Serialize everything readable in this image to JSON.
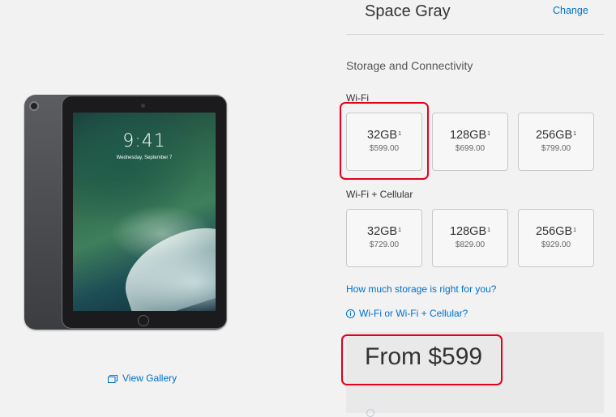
{
  "product": {
    "lockscreen_time": "9:41",
    "lockscreen_date": "Wednesday, September 7"
  },
  "gallery": {
    "label": "View Gallery",
    "icon": "gallery-icon"
  },
  "color": {
    "name": "Space Gray",
    "change_label": "Change"
  },
  "storage": {
    "section_title": "Storage and Connectivity",
    "wifi": {
      "label": "Wi-Fi",
      "options": [
        {
          "capacity": "32GB",
          "footnote": "1",
          "price": "$599.00"
        },
        {
          "capacity": "128GB",
          "footnote": "1",
          "price": "$699.00"
        },
        {
          "capacity": "256GB",
          "footnote": "1",
          "price": "$799.00"
        }
      ]
    },
    "cellular": {
      "label": "Wi-Fi + Cellular",
      "options": [
        {
          "capacity": "32GB",
          "footnote": "1",
          "price": "$729.00"
        },
        {
          "capacity": "128GB",
          "footnote": "1",
          "price": "$829.00"
        },
        {
          "capacity": "256GB",
          "footnote": "1",
          "price": "$929.00"
        }
      ]
    }
  },
  "links": {
    "storage_help": "How much storage is right for you?",
    "connectivity_help": "Wi-Fi or Wi-Fi + Cellular?",
    "connectivity_icon": "info-icon"
  },
  "summary": {
    "price": "From $599"
  },
  "colors": {
    "link": "#0070c9",
    "annotation": "#e3001b",
    "background": "#f2f2f2"
  }
}
